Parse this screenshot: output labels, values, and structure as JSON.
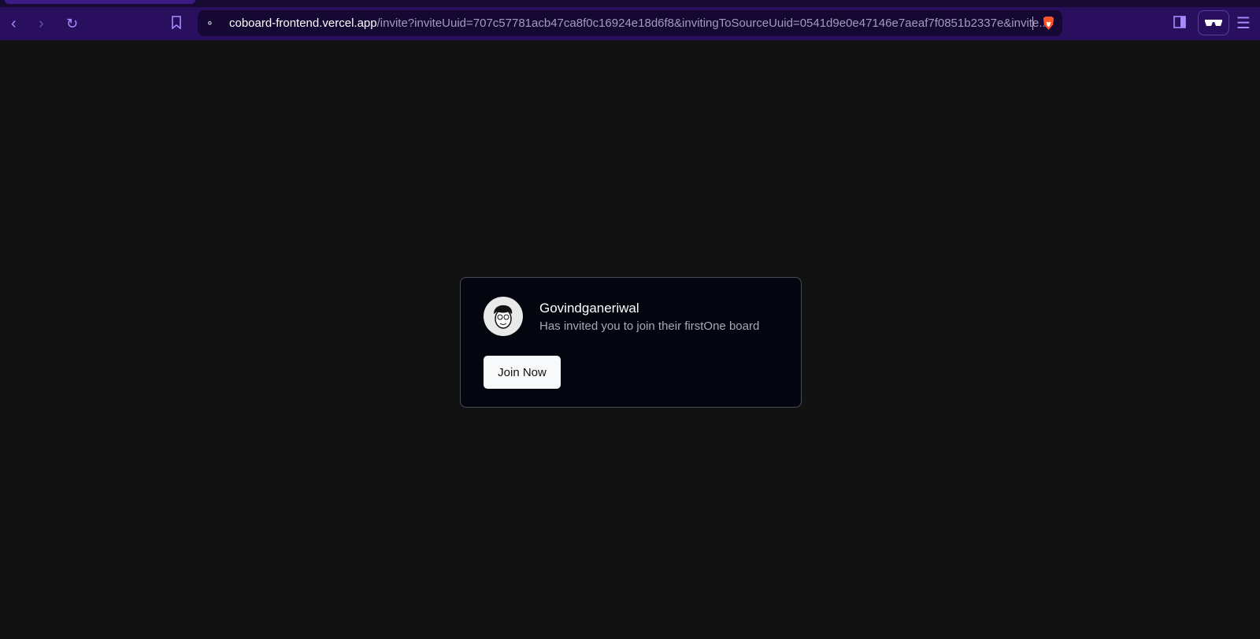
{
  "browser": {
    "url_host": "coboard-frontend.vercel.app",
    "url_path": "/invite?inviteUuid=707c57781acb47ca8f0c16924e18d6f8&invitingToSourceUuid=0541d9e0e47146e7aeaf7f0851b2337e&invite...",
    "icons": [
      "back-icon",
      "forward-icon",
      "reload-icon",
      "bookmark-icon",
      "site-settings-icon",
      "brave-shields-icon",
      "sidebar-icon",
      "reader-mode-icon",
      "menu-icon"
    ],
    "accent": "#2a0f5e"
  },
  "invite": {
    "inviter_name": "Govindganeriwal",
    "message": "Has invited you to join their firstOne board",
    "join_label": "Join Now"
  }
}
